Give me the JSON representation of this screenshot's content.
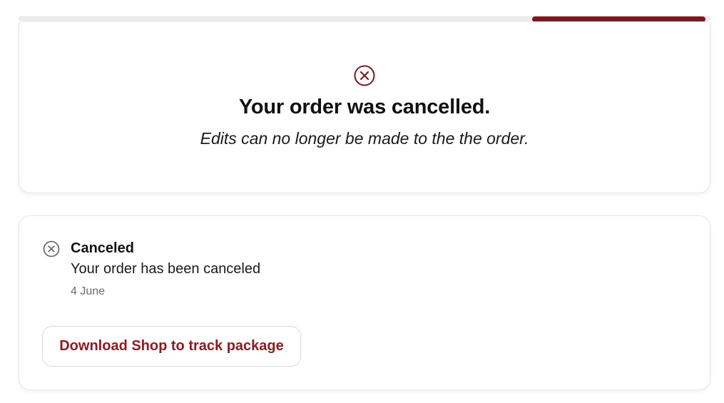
{
  "progress": {
    "fraction": 0.25,
    "color": "#7a1a1f"
  },
  "hero": {
    "icon": "x-circle-icon",
    "icon_color": "#7a1a1f",
    "title": "Your order was cancelled.",
    "subtitle": "Edits can no longer be made to the the order."
  },
  "status": {
    "icon": "x-circle-icon",
    "icon_color": "#707070",
    "title": "Canceled",
    "description": "Your order has been canceled",
    "date": "4 June"
  },
  "actions": {
    "track_button_label": "Download Shop to track package",
    "track_button_color": "#8a1c22"
  }
}
